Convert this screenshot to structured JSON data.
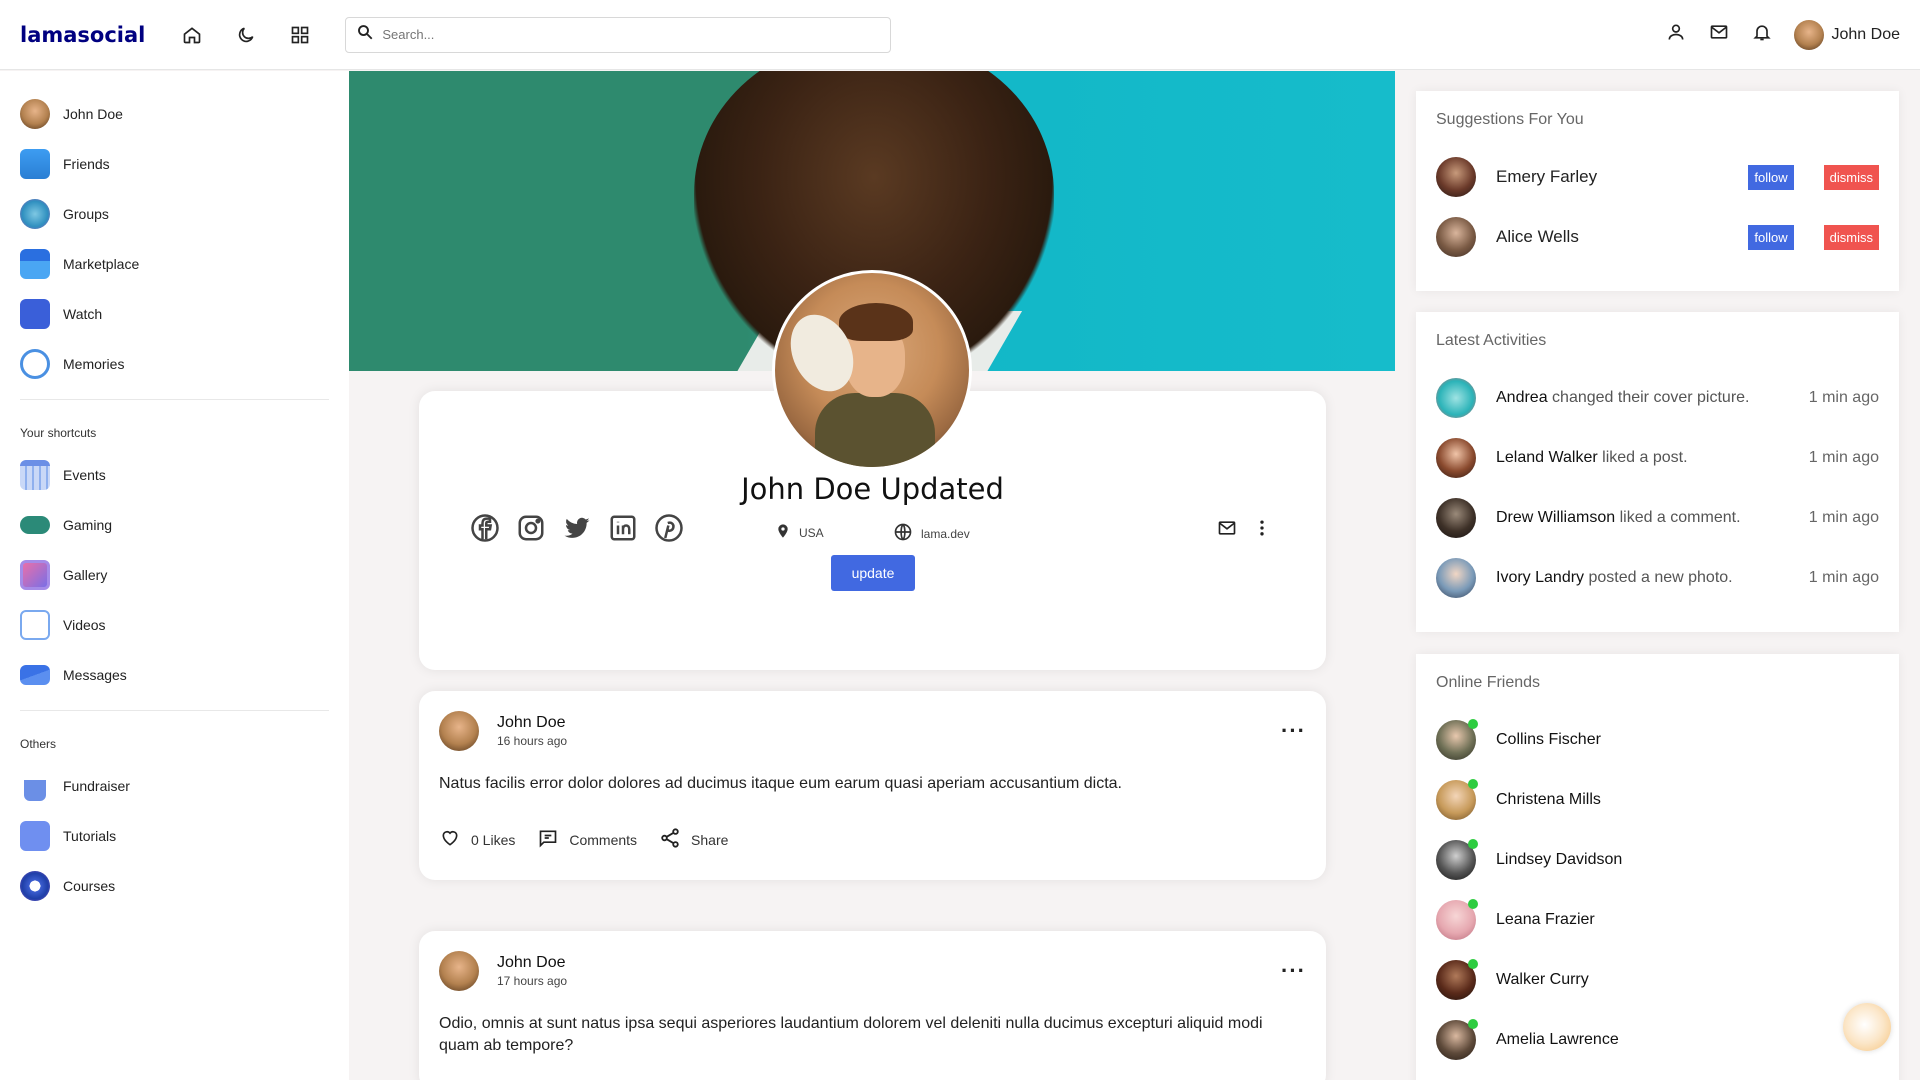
{
  "navbar": {
    "logo": "lamasocial",
    "search_placeholder": "Search...",
    "user_name": "John Doe"
  },
  "leftbar": {
    "menu": [
      {
        "label": "John Doe",
        "icon": "avatar"
      },
      {
        "label": "Friends",
        "icon": "friends-icon"
      },
      {
        "label": "Groups",
        "icon": "groups-icon"
      },
      {
        "label": "Marketplace",
        "icon": "marketplace-icon"
      },
      {
        "label": "Watch",
        "icon": "watch-icon"
      },
      {
        "label": "Memories",
        "icon": "memories-icon"
      }
    ],
    "shortcuts_title": "Your shortcuts",
    "shortcuts": [
      {
        "label": "Events",
        "icon": "events-icon"
      },
      {
        "label": "Gaming",
        "icon": "gaming-icon"
      },
      {
        "label": "Gallery",
        "icon": "gallery-icon"
      },
      {
        "label": "Videos",
        "icon": "videos-icon"
      },
      {
        "label": "Messages",
        "icon": "messages-icon"
      }
    ],
    "others_title": "Others",
    "others": [
      {
        "label": "Fundraiser",
        "icon": "fundraiser-icon"
      },
      {
        "label": "Tutorials",
        "icon": "tutorials-icon"
      },
      {
        "label": "Courses",
        "icon": "courses-icon"
      }
    ]
  },
  "profile": {
    "name": "John Doe Updated",
    "location": "USA",
    "website": "lama.dev",
    "update_label": "update"
  },
  "posts": [
    {
      "author": "John Doe",
      "time": "16 hours ago",
      "text": "Natus facilis error dolor dolores ad ducimus itaque eum earum quasi aperiam accusantium dicta.",
      "likes": "0 Likes",
      "comments": "Comments",
      "share": "Share"
    },
    {
      "author": "John Doe",
      "time": "17 hours ago",
      "text": "Odio, omnis at sunt natus ipsa sequi asperiores laudantium dolorem vel deleniti nulla ducimus excepturi aliquid modi quam ab tempore?"
    }
  ],
  "suggestions": {
    "title": "Suggestions For You",
    "follow_label": "follow",
    "dismiss_label": "dismiss",
    "items": [
      {
        "name": "Emery Farley"
      },
      {
        "name": "Alice Wells"
      }
    ]
  },
  "activities": {
    "title": "Latest Activities",
    "items": [
      {
        "who": "Andrea",
        "what": "changed their cover picture.",
        "time": "1 min ago"
      },
      {
        "who": "Leland Walker",
        "what": "liked a post.",
        "time": "1 min ago"
      },
      {
        "who": "Drew Williamson",
        "what": "liked a comment.",
        "time": "1 min ago"
      },
      {
        "who": "Ivory Landry",
        "what": "posted a new photo.",
        "time": "1 min ago"
      }
    ]
  },
  "online_friends": {
    "title": "Online Friends",
    "items": [
      {
        "name": "Collins Fischer"
      },
      {
        "name": "Christena Mills"
      },
      {
        "name": "Lindsey Davidson"
      },
      {
        "name": "Leana Frazier"
      },
      {
        "name": "Walker Curry"
      },
      {
        "name": "Amelia Lawrence"
      }
    ]
  },
  "colors": {
    "brand": "#000080",
    "primary": "#4169e1",
    "danger": "#f0544f",
    "online": "#2ecc40"
  }
}
